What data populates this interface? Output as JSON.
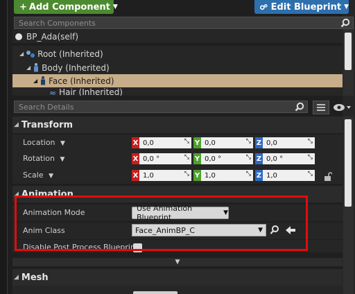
{
  "toolbar": {
    "add_component": "Add Component",
    "edit_blueprint": "Edit Blueprint"
  },
  "components": {
    "search_placeholder": "Search Components",
    "self": "BP_Ada(self)",
    "tree": [
      {
        "label": "Root (Inherited)",
        "icon": "scene-component-icon"
      },
      {
        "label": "Body (Inherited)",
        "icon": "skeletal-mesh-icon"
      },
      {
        "label": "Face (Inherited)",
        "icon": "skeletal-mesh-icon",
        "selected": true
      },
      {
        "label": "Hair (Inherited)",
        "icon": "groom-icon"
      }
    ]
  },
  "details": {
    "search_placeholder": "Search Details",
    "transform": {
      "title": "Transform",
      "location": {
        "label": "Location",
        "x": "0,0",
        "y": "0,0",
        "z": "0,0"
      },
      "rotation": {
        "label": "Rotation",
        "x": "0,0 °",
        "y": "0,0 °",
        "z": "0,0 °"
      },
      "scale": {
        "label": "Scale",
        "x": "1,0",
        "y": "1,0",
        "z": "1,0"
      }
    },
    "animation": {
      "title": "Animation",
      "mode_label": "Animation Mode",
      "mode_value": "Use Animation Blueprint",
      "class_label": "Anim Class",
      "class_value": "Face_AnimBP_C",
      "post_process_label": "Disable Post Process Blueprint",
      "post_process_checked": false
    },
    "mesh": {
      "title": "Mesh"
    }
  },
  "axis_tags": {
    "x": "X",
    "y": "Y",
    "z": "Z"
  },
  "colors": {
    "add_button": "#4c8a2f",
    "edit_button": "#2e6fae",
    "selected_row": "#c8ad8a",
    "highlight": "#e10d0d",
    "axis_x": "#c52121",
    "axis_y": "#4ea12c",
    "axis_z": "#2f69c2"
  }
}
